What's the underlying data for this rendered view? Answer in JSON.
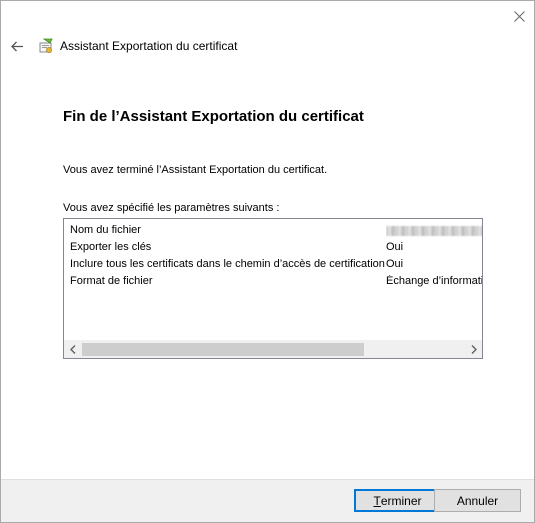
{
  "wizard": {
    "title": "Assistant Exportation du certificat"
  },
  "page": {
    "heading": "Fin de l’Assistant Exportation du certificat",
    "completed_text": "Vous avez terminé l’Assistant Exportation du certificat.",
    "params_label": "Vous avez spécifié les paramètres suivants :"
  },
  "settings": [
    {
      "name": "Nom du fichier",
      "value": ""
    },
    {
      "name": "Exporter les clés",
      "value": "Oui"
    },
    {
      "name": "Inclure tous les certificats dans le chemin d’accès de certification",
      "value": "Oui"
    },
    {
      "name": "Format de fichier",
      "value": "Échange d’informati"
    }
  ],
  "buttons": {
    "finish_mnemonic": "T",
    "finish_rest": "erminer",
    "cancel": "Annuler"
  },
  "icons": {
    "close": "close-icon",
    "back": "back-arrow-icon",
    "wizard": "certificate-wizard-icon",
    "scroll_left": "chevron-left-icon",
    "scroll_right": "chevron-right-icon"
  },
  "colors": {
    "accent": "#0078d7",
    "button_bg": "#e1e1e1",
    "footer_bg": "#f0f0f0"
  }
}
